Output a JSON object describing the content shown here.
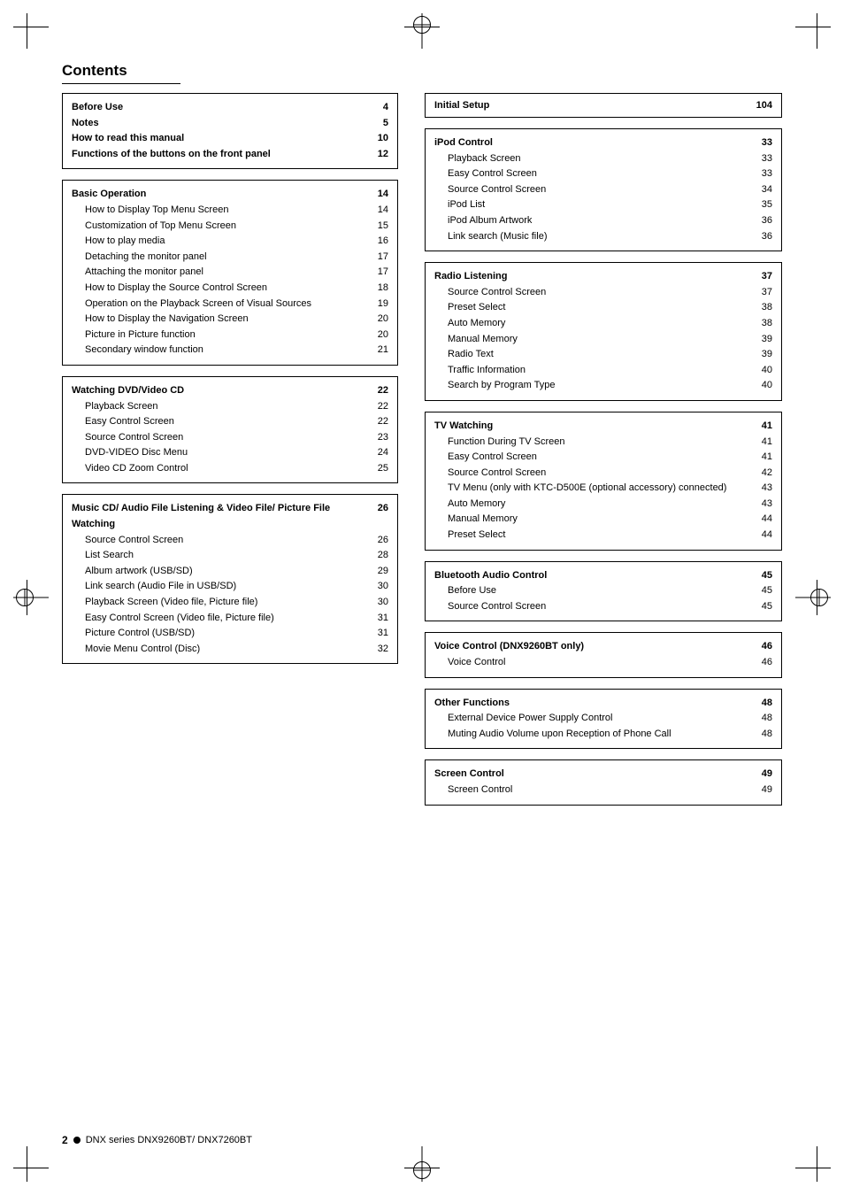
{
  "page": {
    "title": "Contents",
    "footer": {
      "number": "2",
      "series": "DNX series  DNX9260BT/ DNX7260BT"
    }
  },
  "left_col": {
    "top_box": {
      "items": [
        {
          "title": "Before Use",
          "page": "4",
          "bold": true,
          "sub": false
        },
        {
          "title": "Notes",
          "page": "5",
          "bold": true,
          "sub": false
        },
        {
          "title": "How to read this manual",
          "page": "10",
          "bold": true,
          "sub": false
        },
        {
          "title": "Functions of the buttons on the front panel",
          "page": "12",
          "bold": true,
          "sub": false
        }
      ]
    },
    "basic_box": {
      "header": {
        "title": "Basic Operation",
        "page": "14"
      },
      "items": [
        {
          "title": "How to Display Top Menu Screen",
          "page": "14"
        },
        {
          "title": "Customization of Top Menu Screen",
          "page": "15"
        },
        {
          "title": "How to play media",
          "page": "16"
        },
        {
          "title": "Detaching the monitor panel",
          "page": "17"
        },
        {
          "title": "Attaching the monitor panel",
          "page": "17"
        },
        {
          "title": "How to Display the Source Control Screen",
          "page": "18"
        },
        {
          "title": "Operation on the Playback Screen of Visual Sources",
          "page": "19"
        },
        {
          "title": "How to Display the Navigation Screen",
          "page": "20"
        },
        {
          "title": "Picture in Picture function",
          "page": "20"
        },
        {
          "title": "Secondary window function",
          "page": "21"
        }
      ]
    },
    "watching_box": {
      "header": {
        "title": "Watching DVD/Video CD",
        "page": "22"
      },
      "items": [
        {
          "title": "Playback Screen",
          "page": "22"
        },
        {
          "title": "Easy Control Screen",
          "page": "22"
        },
        {
          "title": "Source Control Screen",
          "page": "23"
        },
        {
          "title": "DVD-VIDEO Disc Menu",
          "page": "24"
        },
        {
          "title": "Video CD Zoom Control",
          "page": "25"
        }
      ]
    },
    "music_box": {
      "header": {
        "title": "Music CD/ Audio File Listening & Video File/ Picture File Watching",
        "page": "26"
      },
      "items": [
        {
          "title": "Source Control Screen",
          "page": "26"
        },
        {
          "title": "List Search",
          "page": "28"
        },
        {
          "title": "Album artwork (USB/SD)",
          "page": "29"
        },
        {
          "title": "Link search (Audio File in USB/SD)",
          "page": "30"
        },
        {
          "title": "Playback Screen (Video file, Picture file)",
          "page": "30"
        },
        {
          "title": "Easy Control Screen (Video file, Picture file)",
          "page": "31"
        },
        {
          "title": "Picture Control (USB/SD)",
          "page": "31"
        },
        {
          "title": "Movie Menu Control (Disc)",
          "page": "32"
        }
      ]
    }
  },
  "right_col": {
    "initial_setup": {
      "title": "Initial Setup",
      "page": "104"
    },
    "ipod_box": {
      "header": {
        "title": "iPod Control",
        "page": "33"
      },
      "items": [
        {
          "title": "Playback Screen",
          "page": "33"
        },
        {
          "title": "Easy Control Screen",
          "page": "33"
        },
        {
          "title": "Source Control Screen",
          "page": "34"
        },
        {
          "title": "iPod List",
          "page": "35"
        },
        {
          "title": "iPod Album Artwork",
          "page": "36"
        },
        {
          "title": "Link search (Music file)",
          "page": "36"
        }
      ]
    },
    "radio_box": {
      "header": {
        "title": "Radio Listening",
        "page": "37"
      },
      "items": [
        {
          "title": "Source Control Screen",
          "page": "37"
        },
        {
          "title": "Preset Select",
          "page": "38"
        },
        {
          "title": "Auto Memory",
          "page": "38"
        },
        {
          "title": "Manual Memory",
          "page": "39"
        },
        {
          "title": "Radio Text",
          "page": "39"
        },
        {
          "title": "Traffic Information",
          "page": "40"
        },
        {
          "title": "Search by Program Type",
          "page": "40"
        }
      ]
    },
    "tv_box": {
      "header": {
        "title": "TV Watching",
        "page": "41"
      },
      "items": [
        {
          "title": "Function During TV Screen",
          "page": "41"
        },
        {
          "title": "Easy Control Screen",
          "page": "41"
        },
        {
          "title": "Source Control Screen",
          "page": "42"
        },
        {
          "title": "TV Menu (only with KTC-D500E (optional accessory) connected)",
          "page": "43"
        },
        {
          "title": "Auto Memory",
          "page": "43"
        },
        {
          "title": "Manual Memory",
          "page": "44"
        },
        {
          "title": "Preset Select",
          "page": "44"
        }
      ]
    },
    "bluetooth_box": {
      "header": {
        "title": "Bluetooth Audio Control",
        "page": "45"
      },
      "items": [
        {
          "title": "Before Use",
          "page": "45"
        },
        {
          "title": "Source Control Screen",
          "page": "45"
        }
      ]
    },
    "voice_box": {
      "header": {
        "title": "Voice Control (DNX9260BT only)",
        "page": "46"
      },
      "items": [
        {
          "title": "Voice Control",
          "page": "46"
        }
      ]
    },
    "other_box": {
      "header": {
        "title": "Other Functions",
        "page": "48"
      },
      "items": [
        {
          "title": "External Device Power Supply Control",
          "page": "48"
        },
        {
          "title": "Muting Audio Volume upon Reception of Phone Call",
          "page": "48"
        }
      ]
    },
    "screen_box": {
      "header": {
        "title": "Screen Control",
        "page": "49"
      },
      "items": [
        {
          "title": "Screen Control",
          "page": "49"
        }
      ]
    }
  }
}
